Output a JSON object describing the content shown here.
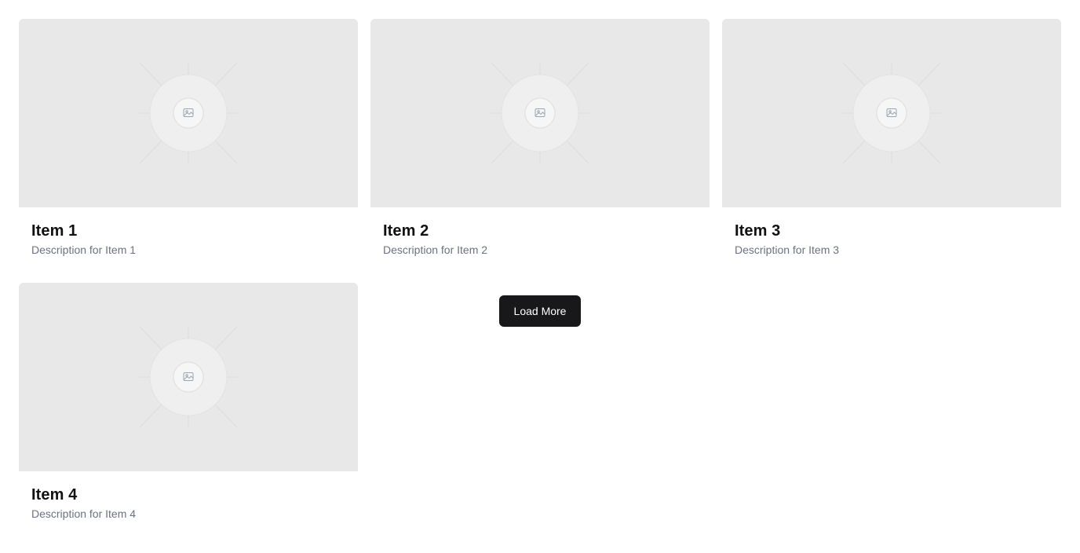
{
  "items": [
    {
      "title": "Item 1",
      "description": "Description for Item 1"
    },
    {
      "title": "Item 2",
      "description": "Description for Item 2"
    },
    {
      "title": "Item 3",
      "description": "Description for Item 3"
    },
    {
      "title": "Item 4",
      "description": "Description for Item 4"
    }
  ],
  "load_more_label": "Load More",
  "placeholder_icon": "image-placeholder-icon",
  "colors": {
    "image_bg": "#e8e8e8",
    "button_bg": "#18181b",
    "button_text": "#ffffff",
    "title": "#111111",
    "description": "#6b7280"
  }
}
